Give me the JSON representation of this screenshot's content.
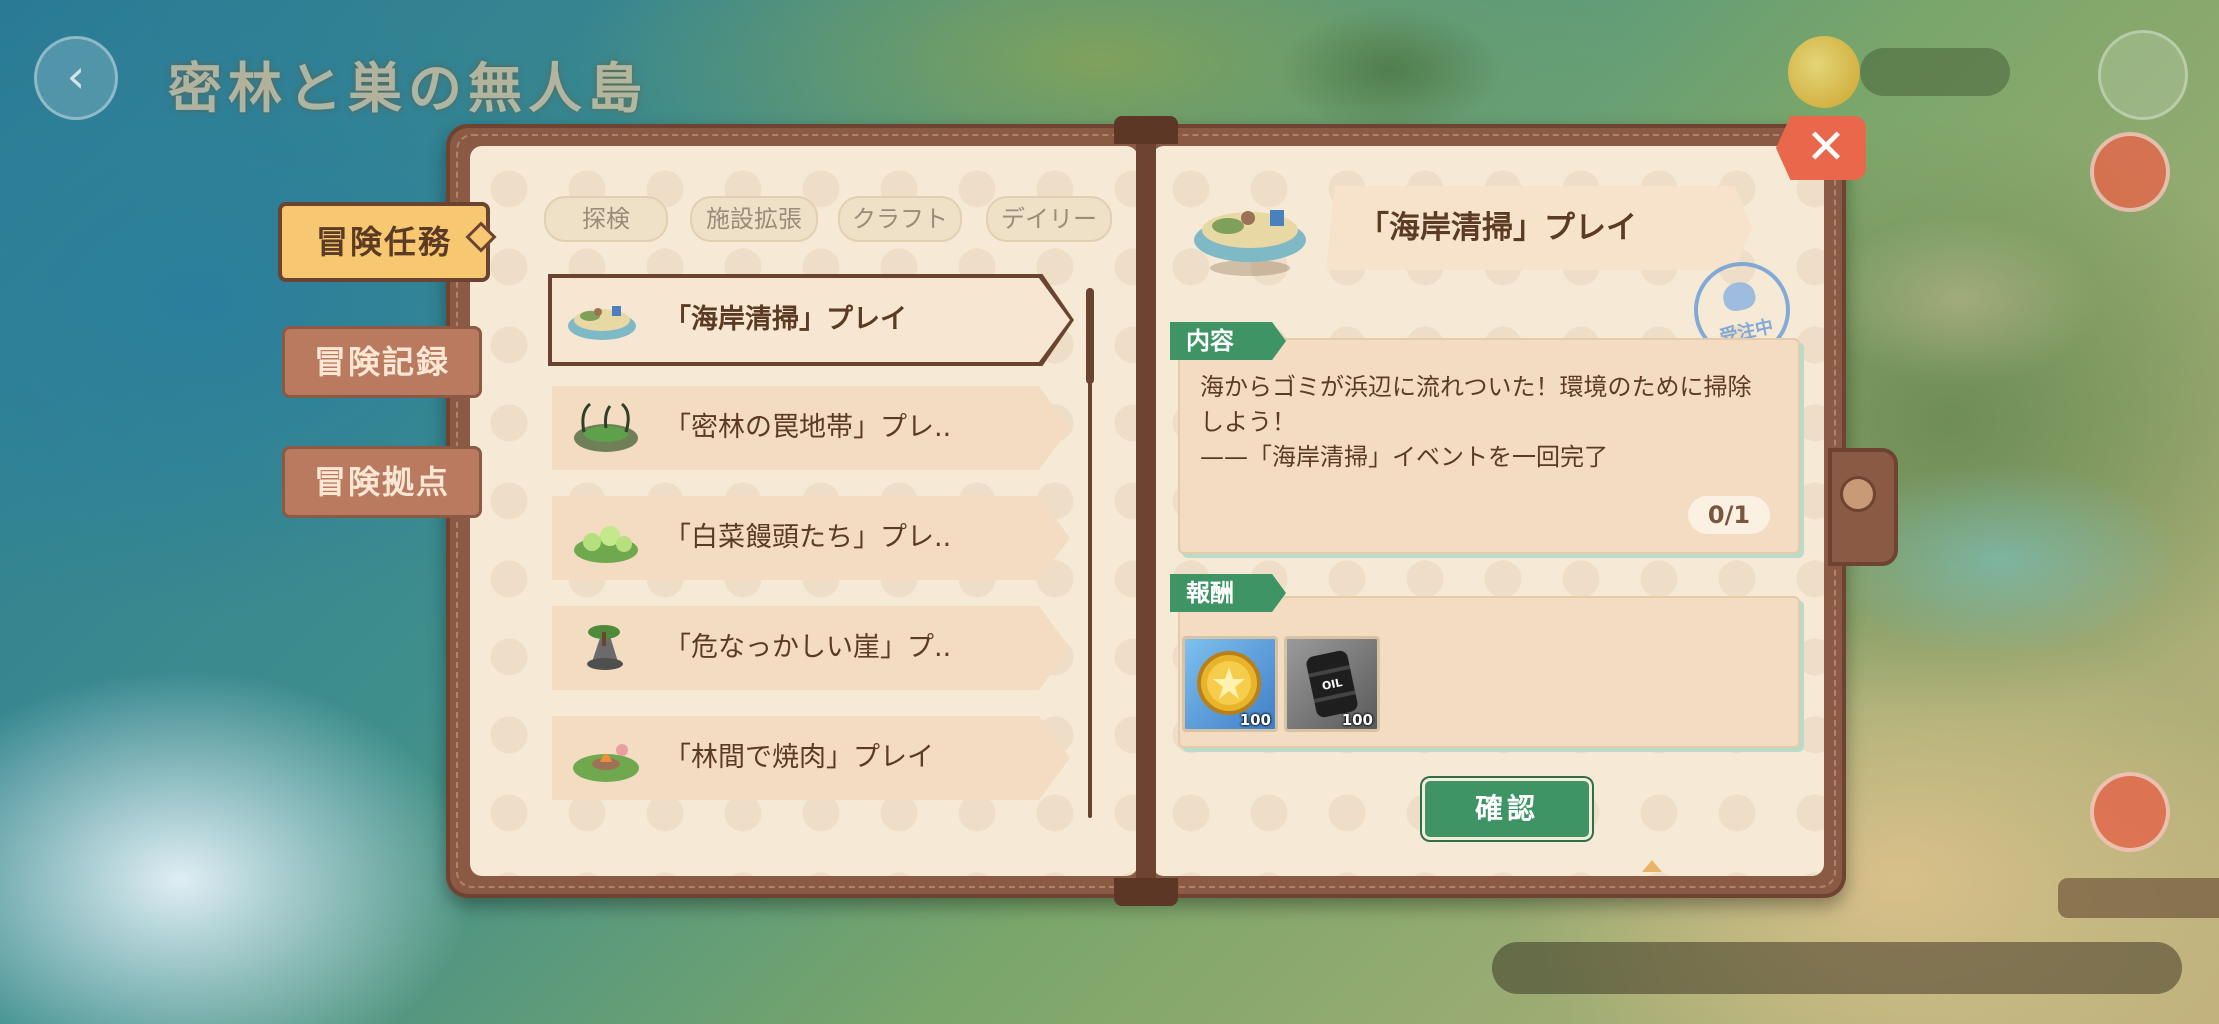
{
  "header": {
    "title": "密林と巣の無人島",
    "back_icon": "back-arrow-icon",
    "coin_icon": "coin-icon",
    "home_icon": "home-icon"
  },
  "close_icon": "close-icon",
  "side_tabs": [
    {
      "label": "冒険任務",
      "active": true
    },
    {
      "label": "冒険記録",
      "active": false
    },
    {
      "label": "冒険拠点",
      "active": false
    }
  ],
  "filter_tabs": [
    "探検",
    "施設拡張",
    "クラフト",
    "デイリー"
  ],
  "quests": [
    {
      "label": "「海岸清掃」プレイ",
      "selected": true,
      "icon": "beach-island-icon"
    },
    {
      "label": "「密林の罠地帯」プレ..",
      "selected": false,
      "icon": "swamp-island-icon"
    },
    {
      "label": "「白菜饅頭たち」プレ..",
      "selected": false,
      "icon": "cabbage-island-icon"
    },
    {
      "label": "「危なっかしい崖」プ..",
      "selected": false,
      "icon": "cliff-island-icon"
    },
    {
      "label": "「林間で焼肉」プレイ",
      "selected": false,
      "icon": "campfire-island-icon"
    }
  ],
  "detail": {
    "title": "「海岸清掃」プレイ",
    "stamp_text": "受注中",
    "content_label": "内容",
    "content_lines": [
      "海からゴミが浜辺に流れついた！環境のために掃除",
      "しよう！",
      "——「海岸清掃」イベントを一回完了"
    ],
    "progress": "0/1",
    "reward_label": "報酬",
    "rewards": [
      {
        "name": "coin-reward-icon",
        "qty": "100"
      },
      {
        "name": "oil-barrel-reward-icon",
        "qty": "100",
        "barrel_text": "OIL"
      }
    ],
    "confirm_label": "確認"
  },
  "colors": {
    "book_brown": "#8a5a44",
    "page": "#f6ead6",
    "accent_green": "#3f9466",
    "close_red": "#e9674a",
    "active_tab": "#f8c772"
  }
}
